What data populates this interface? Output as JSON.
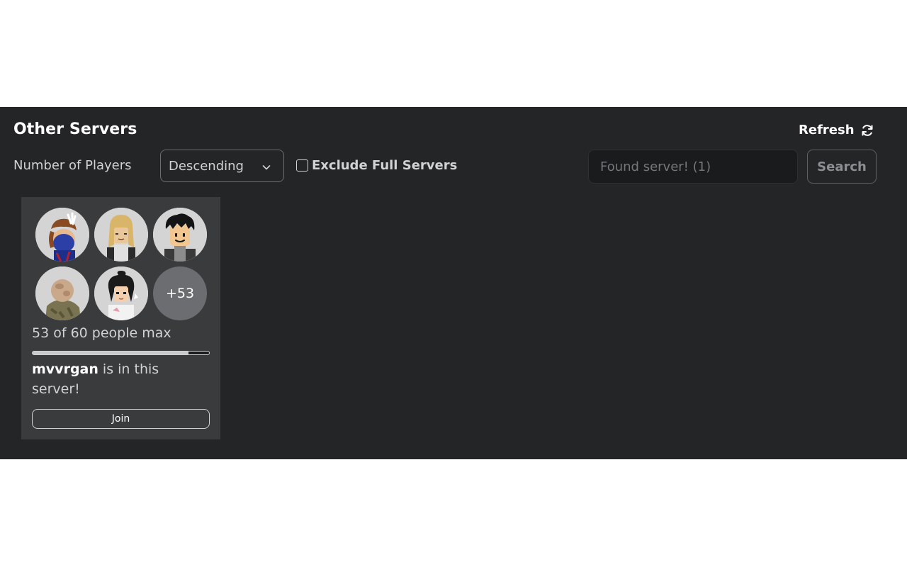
{
  "header": {
    "title": "Other Servers",
    "refresh_label": "Refresh",
    "refresh_icon": "refresh-icon"
  },
  "filters": {
    "label": "Number of Players",
    "sort_value": "Descending",
    "exclude_full_label": "Exclude Full Servers",
    "exclude_full_checked": false,
    "search_placeholder": "Found server! (1)",
    "search_button_label": "Search"
  },
  "server_card": {
    "avatars": [
      "player-avatar-1",
      "player-avatar-2",
      "player-avatar-3",
      "player-avatar-4",
      "player-avatar-5"
    ],
    "more_players_label": "+53",
    "capacity_text": "53 of 60 people max",
    "players_current": 53,
    "players_max": 60,
    "friend_name": "mvvrgan",
    "friend_suffix": " is in this server!",
    "join_label": "Join"
  },
  "colors": {
    "panel_bg": "#232527",
    "card_bg": "#393b3d",
    "text_primary": "#ffffff",
    "text_secondary": "#d0d2d4"
  }
}
